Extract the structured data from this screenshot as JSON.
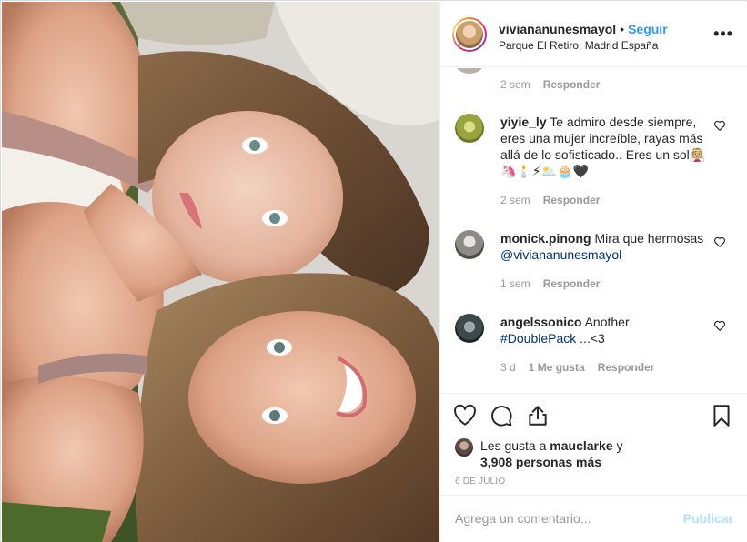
{
  "header": {
    "username": "viviananunesmayol",
    "separator": "•",
    "follow_label": "Seguir",
    "location": "Parque El Retiro, Madrid España",
    "more_label": "•••"
  },
  "comments": {
    "first": {
      "time": "2 sem",
      "reply_label": "Responder"
    },
    "items": [
      {
        "user": "yiyie_ly",
        "text": "Te admiro desde siempre, eres una mujer increíble, rayas más allá de lo sofisticado.. Eres un sol👰🏼🦄🕯️⚡🌥️🧁🖤",
        "time": "2 sem",
        "reply_label": "Responder"
      },
      {
        "user": "monick.pinong",
        "text": "Mira que hermosas ",
        "mention": "@viviananunesmayol",
        "time": "1 sem",
        "reply_label": "Responder"
      },
      {
        "user": "angelssonico",
        "text": "Another ",
        "hashtag": "#DoublePack",
        "text_after": " ...<3",
        "time": "3 d",
        "likes_label": "1 Me gusta",
        "reply_label": "Responder"
      }
    ]
  },
  "actions": {
    "icons": [
      "heart-icon",
      "comment-icon",
      "share-icon",
      "bookmark-icon"
    ]
  },
  "likes": {
    "prefix": "Les gusta a ",
    "user": "mauclarke",
    "middle": " y",
    "count": "3,908 personas más"
  },
  "date": "6 DE JULIO",
  "add_comment": {
    "placeholder": "Agrega un comentario...",
    "publish_label": "Publicar"
  },
  "colors": {
    "accent": "#3897f0",
    "muted": "#999999",
    "publish_disabled": "#b2dffc",
    "border": "#efefef"
  }
}
